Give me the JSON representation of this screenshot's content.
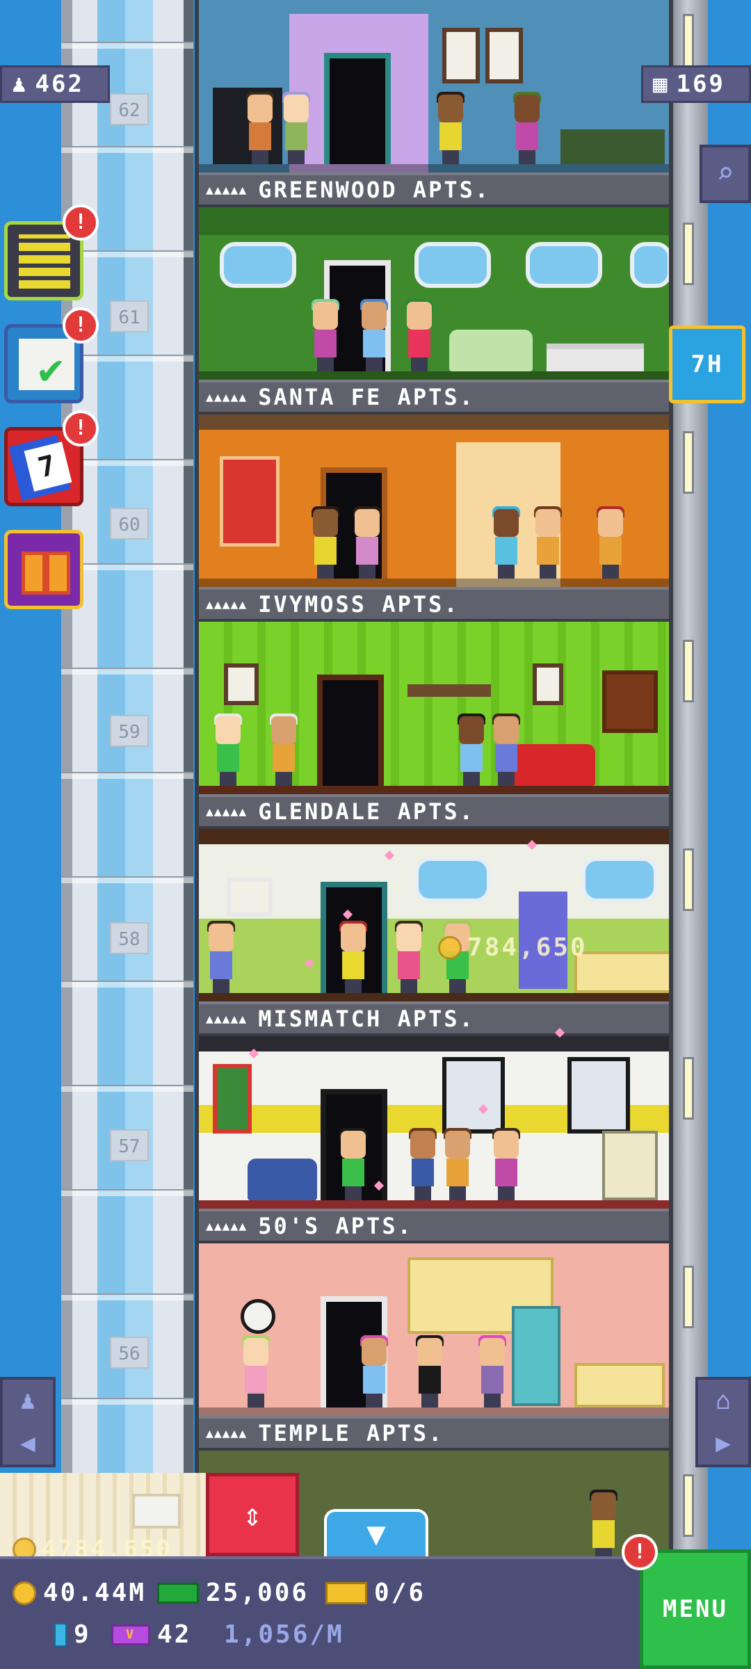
{
  "hud": {
    "population": "462",
    "floor_count": "169",
    "timer_badge": "7H"
  },
  "floors": [
    {
      "name": "GREENWOOD APTS.",
      "number": "62",
      "stars": "▲▲▲▲▲",
      "wall_color": "#4f8fb8",
      "accent": "#c9a6e8"
    },
    {
      "name": "SANTA FE APTS.",
      "number": "61",
      "stars": "▲▲▲▲▲",
      "wall_color": "#3f8a2c",
      "accent": "#2f6e22"
    },
    {
      "name": "IVYMOSS APTS.",
      "number": "60",
      "stars": "▲▲▲▲▲",
      "wall_color": "#e2801f",
      "accent": "#c75a12"
    },
    {
      "name": "GLENDALE APTS.",
      "number": "59",
      "stars": "▲▲▲▲▲",
      "wall_color": "#7ad12a",
      "accent": "#5aa31a"
    },
    {
      "name": "MISMATCH APTS.",
      "number": "58",
      "stars": "▲▲▲▲▲",
      "wall_color": "#eef0e6",
      "accent": "#a9d35a"
    },
    {
      "name": "50'S APTS.",
      "number": "57",
      "stars": "▲▲▲▲▲",
      "wall_color": "#f2f2ee",
      "accent": "#e8d830"
    },
    {
      "name": "TEMPLE APTS.",
      "number": "56",
      "stars": "▲▲▲▲▲",
      "wall_color": "#f3b2a6",
      "accent": "#f6e39a"
    }
  ],
  "floating_earning": "784,650",
  "collect_amount": "4784,650",
  "resources": {
    "coins": "40.44M",
    "bux": "25,006",
    "tickets": "0/6",
    "gems": "9",
    "vip": "42",
    "income": "1,056/M"
  },
  "menu_label": "MENU",
  "alerts": {
    "building": "!",
    "tasks": "!",
    "calendar": "!",
    "menu": "!"
  },
  "calendar_day": "7",
  "colors": {
    "sky": "#2d8fd8",
    "hud": "#5a5c86",
    "menu": "#2fbf4b",
    "alert": "#e23a3a"
  },
  "icons": {
    "population": "person-icon",
    "floors": "building-icon",
    "search": "magnifier-icon",
    "elevator": "up-down-arrows-icon",
    "scroll": "chevron-down-icon"
  }
}
